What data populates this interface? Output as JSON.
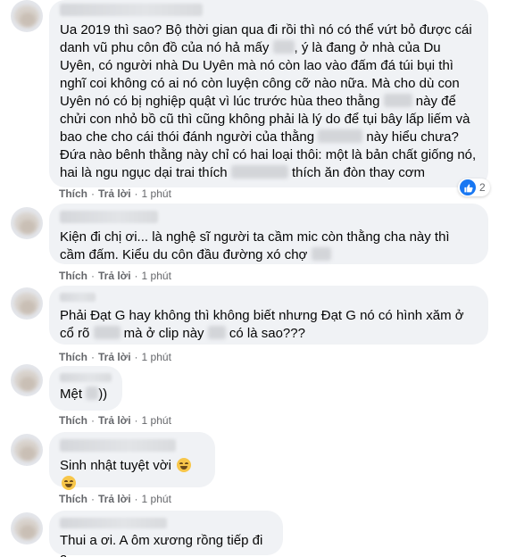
{
  "labels": {
    "like": "Thích",
    "reply": "Trả lời",
    "dot": "·"
  },
  "comments": [
    {
      "text_parts": [
        "Ua 2019 thì sao? Bộ thời gian qua đi rồi thì nó có thể vứt bỏ được cái danh vũ phu côn đồ của nó hả mấy ",
        ", ý là đang ở nhà của Du Uyên, có người nhà Du Uyên mà nó còn lao vào đấm đá túi bụi thì nghĩ coi không có ai nó còn luyện công cỡ nào nữa. Mà cho dù con Uyên nó có bị nghiệp quật vì lúc trước hùa theo thằng ",
        " này để chửi con nhỏ bồ cũ thì cũng không phải là lý do để tụi bây lấp liếm và bao che cho cái thói đánh người của thằng ",
        " này hiểu chưa? Đứa nào bênh thằng này chỉ có hai loại thôi: một là bản chất giống nó, hai là ngu ngục dại trai thích ",
        " thích ăn đòn thay cơm"
      ],
      "time": "1 phút",
      "reaction_count": "2"
    },
    {
      "text_parts": [
        "Kiện đi chị ơi... là nghệ sĩ người ta cầm mic còn thằng cha này thì cầm đấm. Kiểu du côn đầu đường xó chợ ",
        ""
      ],
      "time": "1 phút"
    },
    {
      "text_parts": [
        "Phải Đạt G hay không thì không biết nhưng Đạt G nó có hình xăm ở cổ rõ ",
        " mà ở clip này ",
        " có là sao???"
      ],
      "time": "1 phút"
    },
    {
      "text_parts": [
        "Mệt ",
        "))"
      ],
      "time": "1 phút"
    },
    {
      "text_parts": [
        "Sinh nhật tuyệt vời "
      ],
      "emoji_icons": [
        "grinning-face-icon",
        "grinning-face-icon"
      ],
      "time": "1 phút"
    },
    {
      "text_parts": [
        "Thui a ơi. A ôm xương rồng tiếp đi a"
      ]
    }
  ],
  "colors": {
    "bubble": "#f0f2f5",
    "meta": "#65676b",
    "like_blue": "#1877f2"
  }
}
